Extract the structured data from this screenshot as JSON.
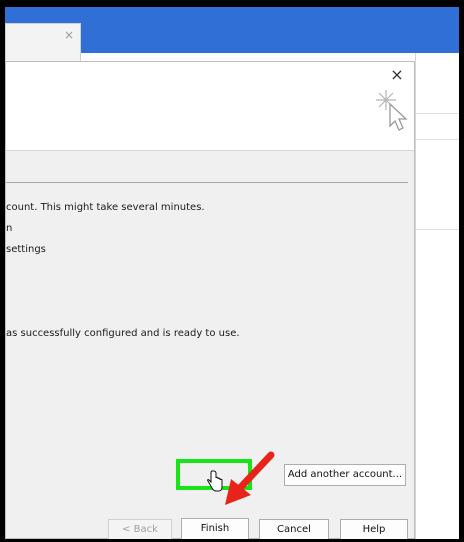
{
  "background_tab": {
    "close_glyph": "×"
  },
  "dialog": {
    "close_glyph": "×",
    "header_icon": "wizard-star-cursor-icon",
    "progress_lines": [
      "count. This might take several minutes.",
      "n",
      "settings"
    ],
    "success_message": "as successfully configured and is ready to use.",
    "buttons": {
      "add_account": "Add another account...",
      "back": "< Back",
      "finish": "Finish",
      "cancel": "Cancel",
      "help": "Help"
    }
  },
  "annotations": {
    "arrow_color": "#e8241a",
    "highlight_color": "#19e419",
    "icons": [
      "red-arrow-icon",
      "pointer-cursor-icon"
    ]
  }
}
